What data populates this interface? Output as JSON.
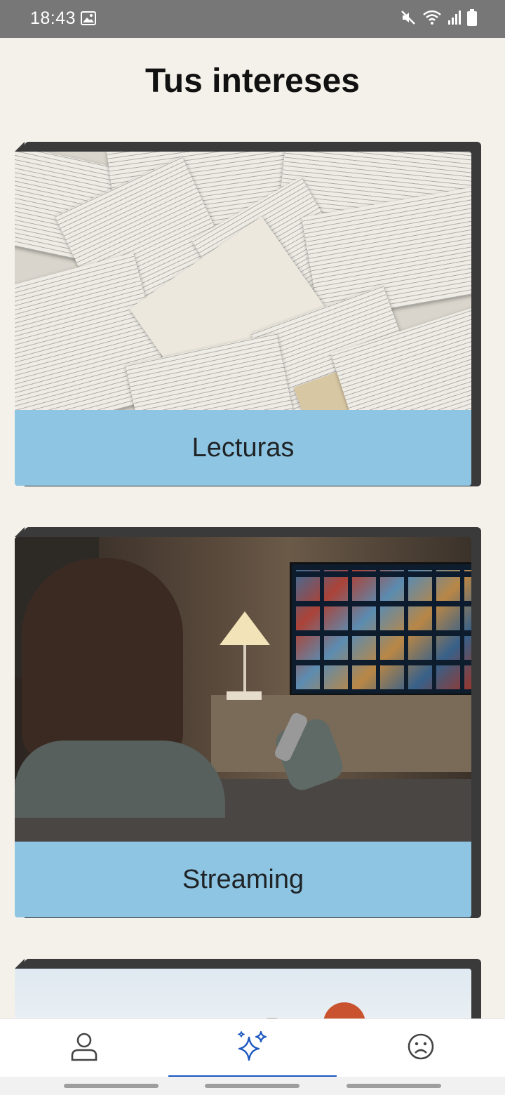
{
  "status_bar": {
    "time": "18:43"
  },
  "page": {
    "title": "Tus intereses"
  },
  "interests": [
    {
      "label": "Lecturas",
      "image": "open-books-photo"
    },
    {
      "label": "Streaming",
      "image": "person-watching-tv-photo"
    },
    {
      "label": "",
      "image": "outdoor-person-photo"
    }
  ],
  "bottom_nav": {
    "items": [
      {
        "icon": "person-icon",
        "active": false
      },
      {
        "icon": "sparkles-icon",
        "active": true
      },
      {
        "icon": "sad-face-icon",
        "active": false
      }
    ]
  },
  "colors": {
    "accent": "#1a57c0",
    "card_label_bg": "#8ec5e2",
    "background": "#f4f1ea"
  }
}
